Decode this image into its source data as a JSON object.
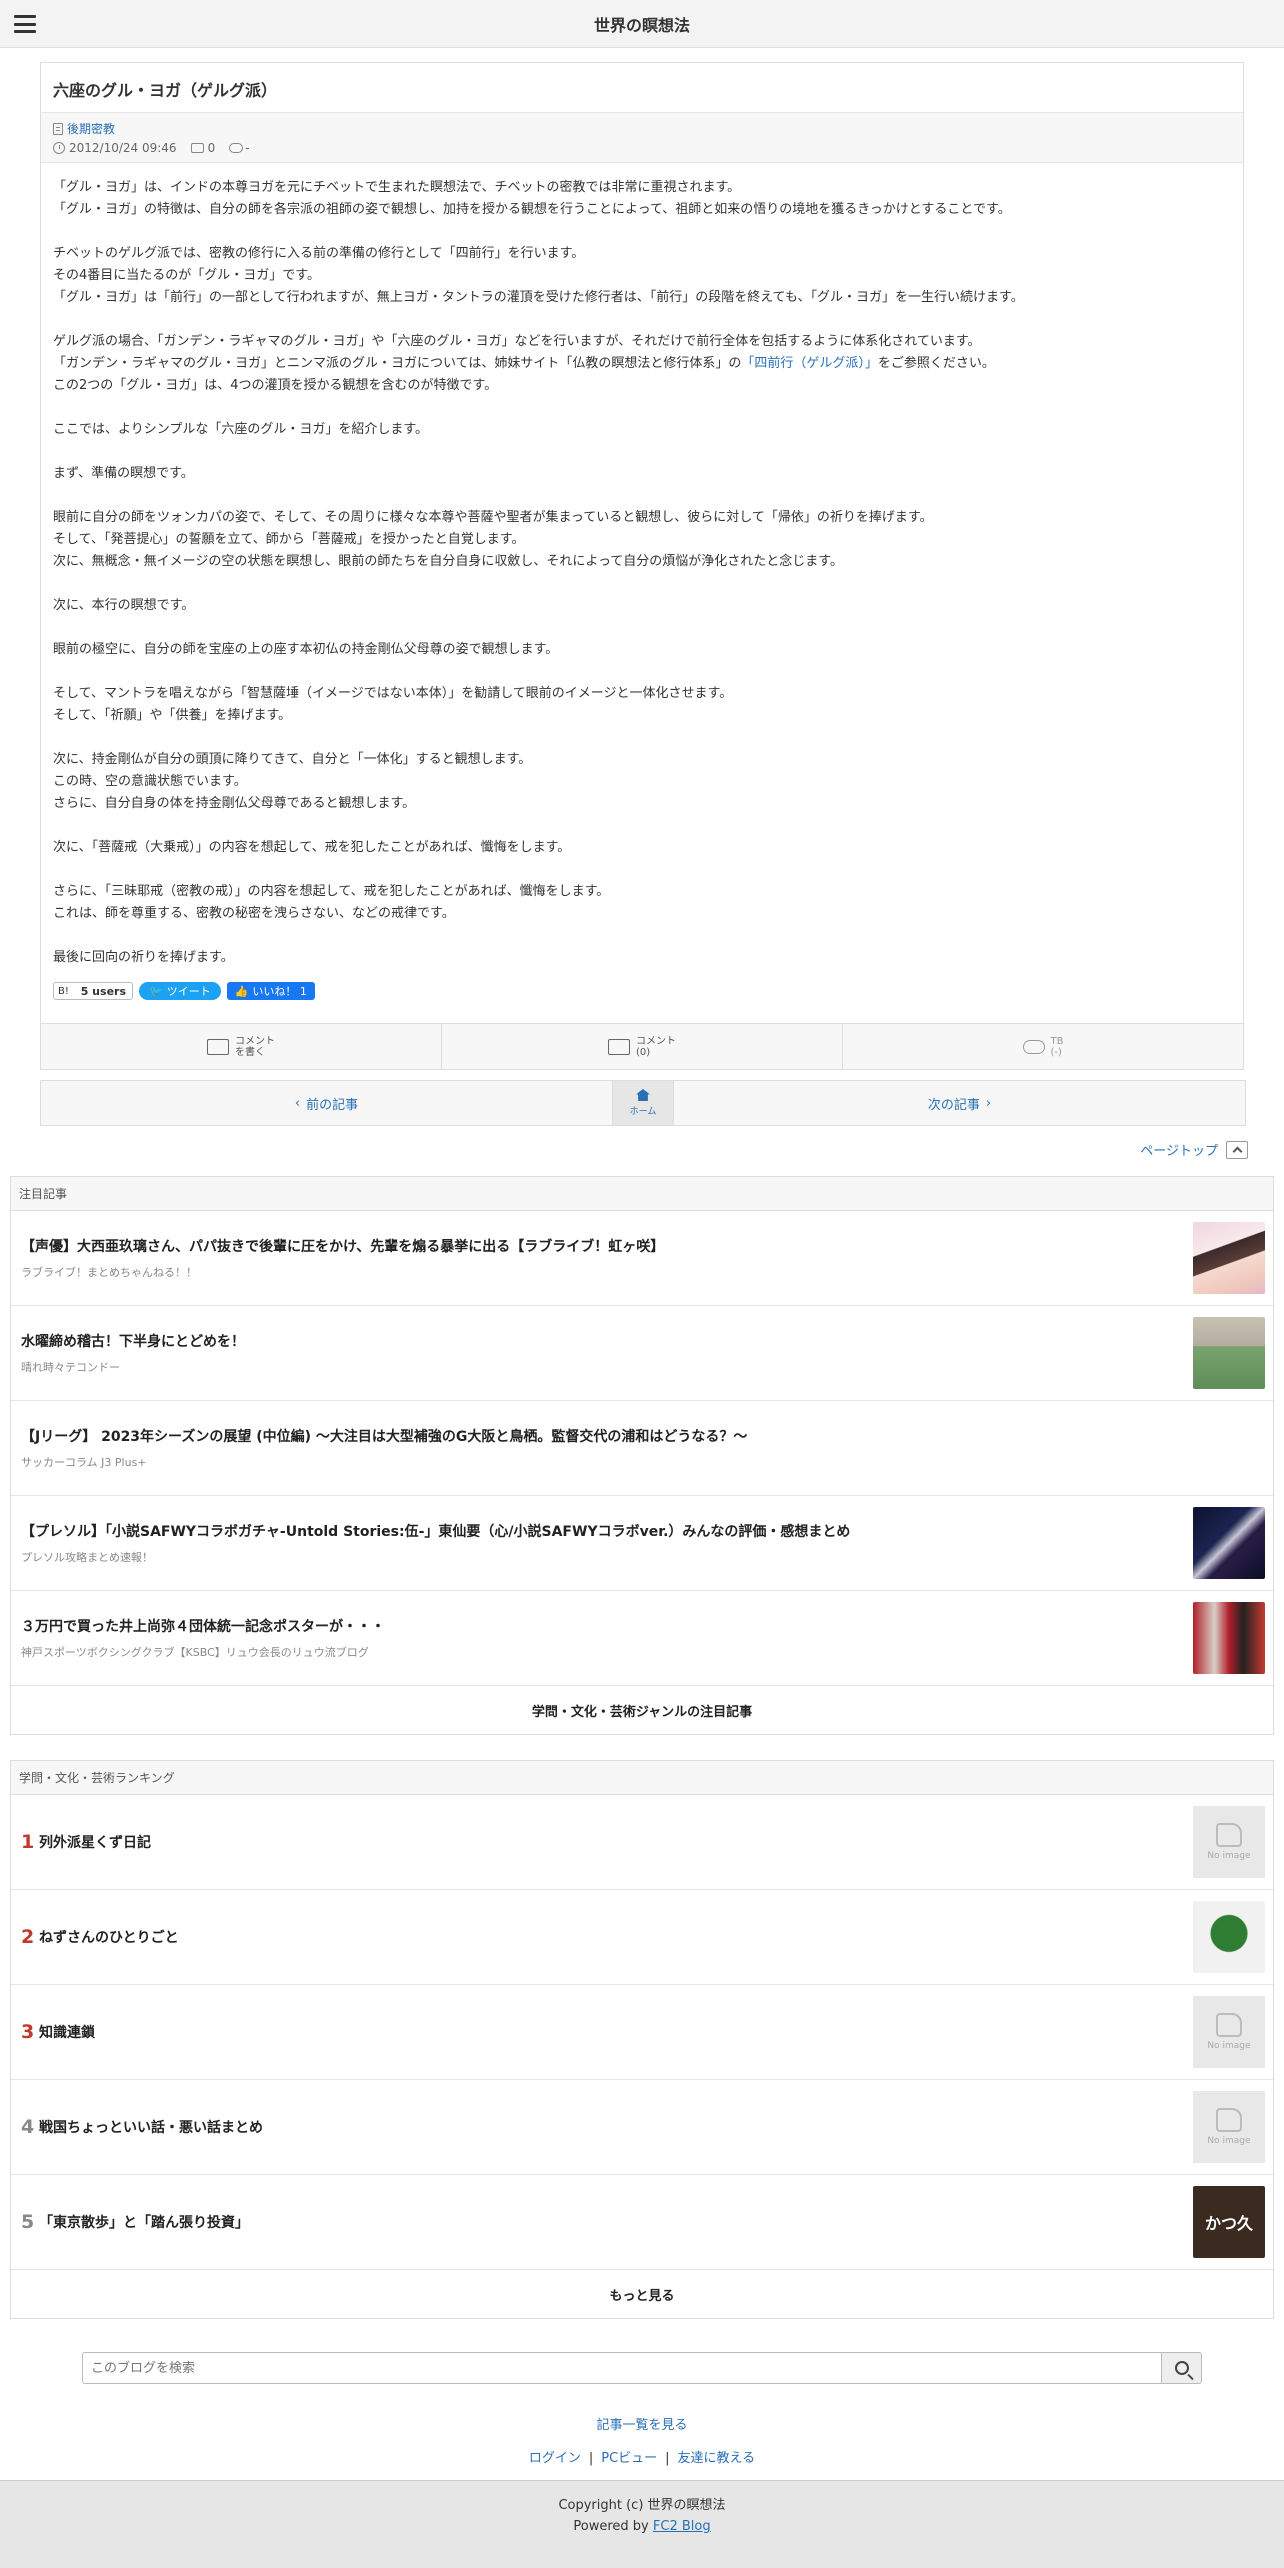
{
  "header": {
    "title": "世界の瞑想法"
  },
  "article": {
    "title": "六座のグル・ヨガ（ゲルグ派）",
    "category": "後期密教",
    "date": "2012/10/24 09:46",
    "comment_count": "0",
    "tb_count": "-",
    "paragraphs": [
      "「グル・ヨガ」は、インドの本尊ヨガを元にチベットで生まれた瞑想法で、チベットの密教では非常に重視されます。",
      "「グル・ヨガ」の特徴は、自分の師を各宗派の祖師の姿で観想し、加持を授かる観想を行うことによって、祖師と如来の悟りの境地を獲るきっかけとすることです。",
      "",
      "チベットのゲルグ派では、密教の修行に入る前の準備の修行として「四前行」を行います。",
      "その4番目に当たるのが「グル・ヨガ」です。",
      "「グル・ヨガ」は「前行」の一部として行われますが、無上ヨガ・タントラの灌頂を受けた修行者は、「前行」の段階を終えても、「グル・ヨガ」を一生行い続けます。",
      "",
      "ゲルグ派の場合、「ガンデン・ラギャマのグル・ヨガ」や「六座のグル・ヨガ」などを行いますが、それだけで前行全体を包括するように体系化されています。",
      "__LINKLINE__",
      "この2つの「グル・ヨガ」は、4つの灌頂を授かる観想を含むのが特徴です。",
      "",
      "ここでは、よりシンプルな「六座のグル・ヨガ」を紹介します。",
      "",
      "まず、準備の瞑想です。",
      "",
      "眼前に自分の師をツォンカパの姿で、そして、その周りに様々な本尊や菩薩や聖者が集まっていると観想し、彼らに対して「帰依」の祈りを捧げます。",
      "そして、「発菩提心」の誓願を立て、師から「菩薩戒」を授かったと自覚します。",
      "次に、無概念・無イメージの空の状態を瞑想し、眼前の師たちを自分自身に収斂し、それによって自分の煩悩が浄化されたと念じます。",
      "",
      "次に、本行の瞑想です。",
      "",
      "眼前の極空に、自分の師を宝座の上の座す本初仏の持金剛仏父母尊の姿で観想します。",
      "",
      "そして、マントラを唱えながら「智慧薩埵（イメージではない本体）」を勧請して眼前のイメージと一体化させます。",
      "そして、「祈願」や「供養」を捧げます。",
      "",
      "次に、持金剛仏が自分の頭頂に降りてきて、自分と「一体化」すると観想します。",
      "この時、空の意識状態でいます。",
      "さらに、自分自身の体を持金剛仏父母尊であると観想します。",
      "",
      "次に、「菩薩戒（大乗戒）」の内容を想起して、戒を犯したことがあれば、懺悔をします。",
      "",
      "さらに、「三昧耶戒（密教の戒）」の内容を想起して、戒を犯したことがあれば、懺悔をします。",
      "これは、師を尊重する、密教の秘密を洩らさない、などの戒律です。",
      "",
      "最後に回向の祈りを捧げます。"
    ],
    "link_line": {
      "before": "「ガンデン・ラギャマのグル・ヨガ」とニンマ派のグル・ヨガについては、姉妹サイト「仏教の瞑想法と修行体系」の",
      "link": "「四前行（ゲルグ派）」",
      "after": "をご参照ください。"
    },
    "social": {
      "hatena_label": "B!",
      "hatena_count": "5 users",
      "tweet": "ツイート",
      "like": "いいね！ 1"
    },
    "actions": {
      "comment_write_1": "コメント",
      "comment_write_2": "を書く",
      "comment_1": "コメント",
      "comment_2": "(0)",
      "tb_1": "TB",
      "tb_2": "(-)"
    }
  },
  "pager": {
    "prev": "前の記事",
    "home": "ホーム",
    "next": "次の記事"
  },
  "pagetop": "ページトップ",
  "featured": {
    "heading": "注目記事",
    "items": [
      {
        "title": "【声優】大西亜玖璃さん、パパ抜きで後輩に圧をかけ、先輩を煽る暴挙に出る【ラブライブ！虹ヶ咲】",
        "source": "ラブライブ！まとめちゃんねる！！"
      },
      {
        "title": "水曜締め稽古！下半身にとどめを！",
        "source": "晴れ時々テコンドー"
      },
      {
        "title": "【Jリーグ】 2023年シーズンの展望 (中位編) ～大注目は大型補強のG大阪と鳥栖。監督交代の浦和はどうなる？～",
        "source": "サッカーコラム J3 Plus+"
      },
      {
        "title": "【プレソル】「小説SAFWYコラボガチャ-Untold Stories:伍-」東仙要（心/小説SAFWYコラボver.）みんなの評価・感想まとめ",
        "source": "プレソル攻略まとめ速報！"
      },
      {
        "title": "３万円で買った井上尚弥４団体統一記念ポスターが・・・",
        "source": "神戸スポーツボクシングクラブ【KSBC】リュウ会長のリュウ流ブログ"
      }
    ],
    "footer": "学問・文化・芸術ジャンルの注目記事"
  },
  "ranking": {
    "heading": "学問・文化・芸術ランキング",
    "no_image": "No image",
    "items": [
      {
        "rank": "1",
        "name": "列外派星くず日記"
      },
      {
        "rank": "2",
        "name": "ねずさんのひとりごと"
      },
      {
        "rank": "3",
        "name": "知識連鎖"
      },
      {
        "rank": "4",
        "name": "戦国ちょっといい話・悪い話まとめ"
      },
      {
        "rank": "5",
        "name": "「東京散歩」と「踏ん張り投資」"
      }
    ],
    "thumb5_text": "かつ久",
    "footer": "もっと見る"
  },
  "search": {
    "placeholder": "このブログを検索"
  },
  "links": {
    "all_articles": "記事一覧を見る",
    "login": "ログイン",
    "sep": "|",
    "pc_view": "PCビュー",
    "tell_friend": "友達に教える"
  },
  "footer": {
    "copyright": "Copyright (c) 世界の瞑想法",
    "powered_by": "Powered by",
    "fc2": "FC2 Blog"
  },
  "colors": {
    "link": "#2a6fb5",
    "rank_top": "#c0392b",
    "twitter": "#1da1f2",
    "facebook": "#1877f2"
  }
}
